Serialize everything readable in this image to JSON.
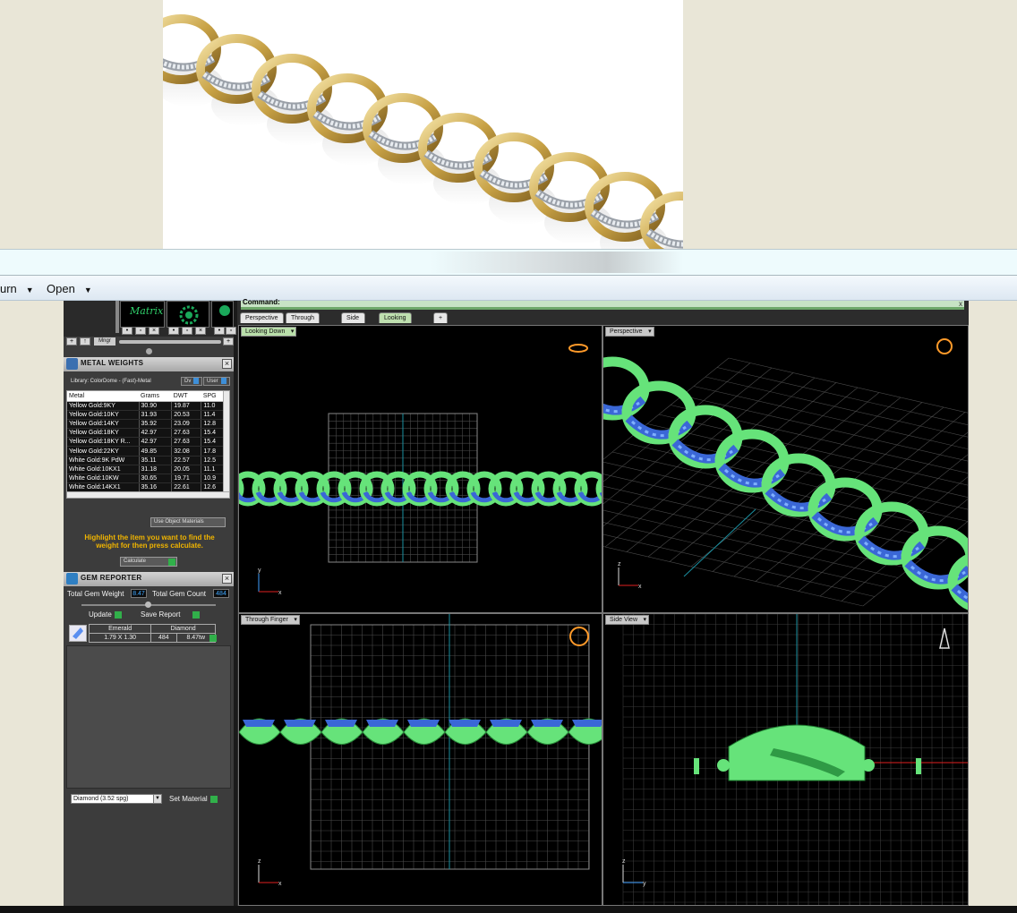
{
  "menubar": {
    "items": [
      "urn",
      "Open"
    ]
  },
  "thumbnails": {
    "first_label": "Matrix"
  },
  "toolbar": {
    "mngr_label": "Mngr"
  },
  "metal_weights": {
    "title": "METAL WEIGHTS",
    "library_label": "Library: ColorDome - (Fast)-Metal",
    "btn_dv": "Dv",
    "btn_user": "User",
    "columns": [
      "Metal",
      "Grams",
      "DWT",
      "SPG"
    ],
    "rows": [
      [
        "Yellow Gold:9KY",
        "30.90",
        "19.87",
        "11.0"
      ],
      [
        "Yellow Gold:10KY",
        "31.93",
        "20.53",
        "11.4"
      ],
      [
        "Yellow Gold:14KY",
        "35.92",
        "23.09",
        "12.8"
      ],
      [
        "Yellow Gold:18KY",
        "42.97",
        "27.63",
        "15.4"
      ],
      [
        "Yellow Gold:18KY R...",
        "42.97",
        "27.63",
        "15.4"
      ],
      [
        "Yellow Gold:22KY",
        "49.85",
        "32.08",
        "17.8"
      ],
      [
        "White Gold:9K PdW",
        "35.11",
        "22.57",
        "12.5"
      ],
      [
        "White Gold:10KX1",
        "31.18",
        "20.05",
        "11.1"
      ],
      [
        "White Gold:10KW",
        "30.65",
        "19.71",
        "10.9"
      ],
      [
        "White Gold:14KX1",
        "35.16",
        "22.61",
        "12.6"
      ],
      [
        "White Gold:14K PdW",
        "40.07",
        "25.77",
        "14.3"
      ]
    ],
    "use_object_materials": "Use Object Materials",
    "hint": "Highlight the item you want to find the weight for then press calculate.",
    "calculate": "Calculate"
  },
  "gem_reporter": {
    "title": "GEM REPORTER",
    "total_weight_label": "Total Gem Weight",
    "total_weight_value": "8.47",
    "total_count_label": "Total Gem Count",
    "total_count_value": "484",
    "update": "Update",
    "save_report": "Save Report",
    "table": [
      [
        "Emerald",
        "Diamond"
      ],
      [
        "1.79 X 1.30",
        "484",
        "8.47tw"
      ]
    ],
    "material_select": "Diamond    (3.52 spg)",
    "set_material": "Set Material"
  },
  "command": {
    "label": "Command:",
    "close": "x"
  },
  "view_tabs": [
    "Perspective",
    "Through Finger",
    "Side View",
    "Looking Down",
    "+"
  ],
  "viewports": {
    "top_left": "Looking Down",
    "top_right": "Perspective",
    "bottom_left": "Through Finger",
    "bottom_right": "Side View"
  },
  "axes": {
    "x": "x",
    "y": "y",
    "z": "z"
  },
  "colors": {
    "metal_green": "#66e37a",
    "gem_blue": "#3a67d6",
    "axis_red": "#e02020",
    "axis_blue": "#2070ff",
    "grid": "#4a4a4a",
    "accent_green": "#31b04a",
    "hint_yellow": "#f0b400"
  }
}
